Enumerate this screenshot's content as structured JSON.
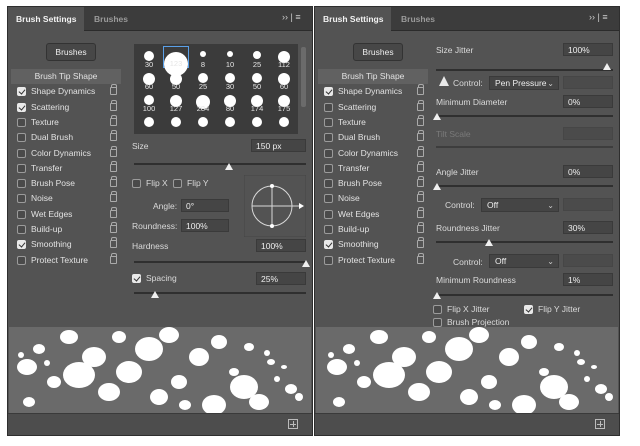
{
  "left": {
    "tabs": {
      "active": "Brush Settings",
      "inactive": "Brushes"
    },
    "menu_glyph": "›› | ≡",
    "brushes_button": "Brushes",
    "items": [
      {
        "label": "Brush Tip Shape",
        "checked": null,
        "lock": false
      },
      {
        "label": "Shape Dynamics",
        "checked": true,
        "lock": true
      },
      {
        "label": "Scattering",
        "checked": true,
        "lock": true
      },
      {
        "label": "Texture",
        "checked": false,
        "lock": true
      },
      {
        "label": "Dual Brush",
        "checked": false,
        "lock": true
      },
      {
        "label": "Color Dynamics",
        "checked": false,
        "lock": true
      },
      {
        "label": "Transfer",
        "checked": false,
        "lock": true
      },
      {
        "label": "Brush Pose",
        "checked": false,
        "lock": true
      },
      {
        "label": "Noise",
        "checked": false,
        "lock": true
      },
      {
        "label": "Wet Edges",
        "checked": false,
        "lock": true
      },
      {
        "label": "Build-up",
        "checked": false,
        "lock": true
      },
      {
        "label": "Smoothing",
        "checked": true,
        "lock": true
      },
      {
        "label": "Protect Texture",
        "checked": false,
        "lock": true
      }
    ],
    "tips": [
      "30",
      "123",
      "8",
      "10",
      "25",
      "112",
      "60",
      "50",
      "25",
      "30",
      "50",
      "60",
      "100",
      "127",
      "284",
      "80",
      "174",
      "175",
      "",
      "",
      "",
      "",
      "",
      ""
    ],
    "selected_tip": 1,
    "size_label": "Size",
    "size_value": "150 px",
    "size_level": 0.55,
    "flip_x": "Flip X",
    "flip_y": "Flip Y",
    "angle_label": "Angle:",
    "angle_value": "0°",
    "roundness_label": "Roundness:",
    "roundness_value": "100%",
    "hardness_label": "Hardness",
    "hardness_value": "100%",
    "hardness_level": 1.0,
    "spacing_label": "Spacing",
    "spacing_value": "25%",
    "spacing_checked": true,
    "spacing_level": 0.12
  },
  "right": {
    "tabs": {
      "active": "Brush Settings",
      "inactive": "Brushes"
    },
    "menu_glyph": "›› | ≡",
    "brushes_button": "Brushes",
    "items": [
      {
        "label": "Brush Tip Shape",
        "checked": null,
        "lock": false
      },
      {
        "label": "Shape Dynamics",
        "checked": true,
        "lock": true
      },
      {
        "label": "Scattering",
        "checked": false,
        "lock": true
      },
      {
        "label": "Texture",
        "checked": false,
        "lock": true
      },
      {
        "label": "Dual Brush",
        "checked": false,
        "lock": true
      },
      {
        "label": "Color Dynamics",
        "checked": false,
        "lock": true
      },
      {
        "label": "Transfer",
        "checked": false,
        "lock": true
      },
      {
        "label": "Brush Pose",
        "checked": false,
        "lock": true
      },
      {
        "label": "Noise",
        "checked": false,
        "lock": true
      },
      {
        "label": "Wet Edges",
        "checked": false,
        "lock": true
      },
      {
        "label": "Build-up",
        "checked": false,
        "lock": true
      },
      {
        "label": "Smoothing",
        "checked": true,
        "lock": true
      },
      {
        "label": "Protect Texture",
        "checked": false,
        "lock": true
      }
    ],
    "size_jitter_label": "Size Jitter",
    "size_jitter_value": "100%",
    "control_label": "Control:",
    "control1_value": "Pen Pressure",
    "min_diameter_label": "Minimum Diameter",
    "min_diameter_value": "0%",
    "tilt_scale_label": "Tilt Scale",
    "angle_jitter_label": "Angle Jitter",
    "angle_jitter_value": "0%",
    "control2_value": "Off",
    "roundness_jitter_label": "Roundness Jitter",
    "roundness_jitter_value": "30%",
    "control3_value": "Off",
    "min_roundness_label": "Minimum Roundness",
    "min_roundness_value": "1%",
    "flip_x_jitter": "Flip X Jitter",
    "flip_y_jitter": "Flip Y Jitter",
    "brush_projection": "Brush Projection"
  }
}
